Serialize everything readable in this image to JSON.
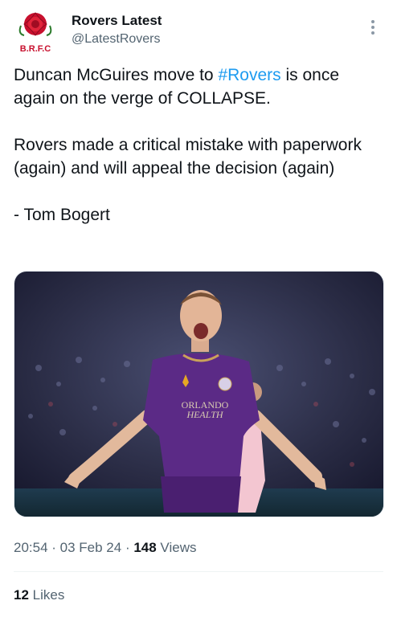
{
  "account": {
    "display_name": "Rovers Latest",
    "handle": "@LatestRovers",
    "avatar_badge_text": "B.R.F.C"
  },
  "tweet": {
    "line1_before": "Duncan McGuires move to ",
    "hashtag": "#Rovers",
    "line1_after": " is once again on the verge of COLLAPSE.",
    "paragraph2": "Rovers made a critical mistake with paperwork (again) and will appeal the decision (again)",
    "paragraph3": "- Tom Bogert"
  },
  "media": {
    "jersey_text_1": "ORLANDO",
    "jersey_text_2": "HEALTH"
  },
  "meta": {
    "time": "20:54",
    "sep1": " · ",
    "date": "03 Feb 24",
    "sep2": " · ",
    "views_count": "148",
    "views_label": " Views"
  },
  "engagement": {
    "likes_count": "12",
    "likes_label": " Likes"
  },
  "colors": {
    "accent": "#1d9bf0",
    "secondary_text": "#536471",
    "primary_text": "#0f1419",
    "jersey_purple": "#5b2a86"
  }
}
